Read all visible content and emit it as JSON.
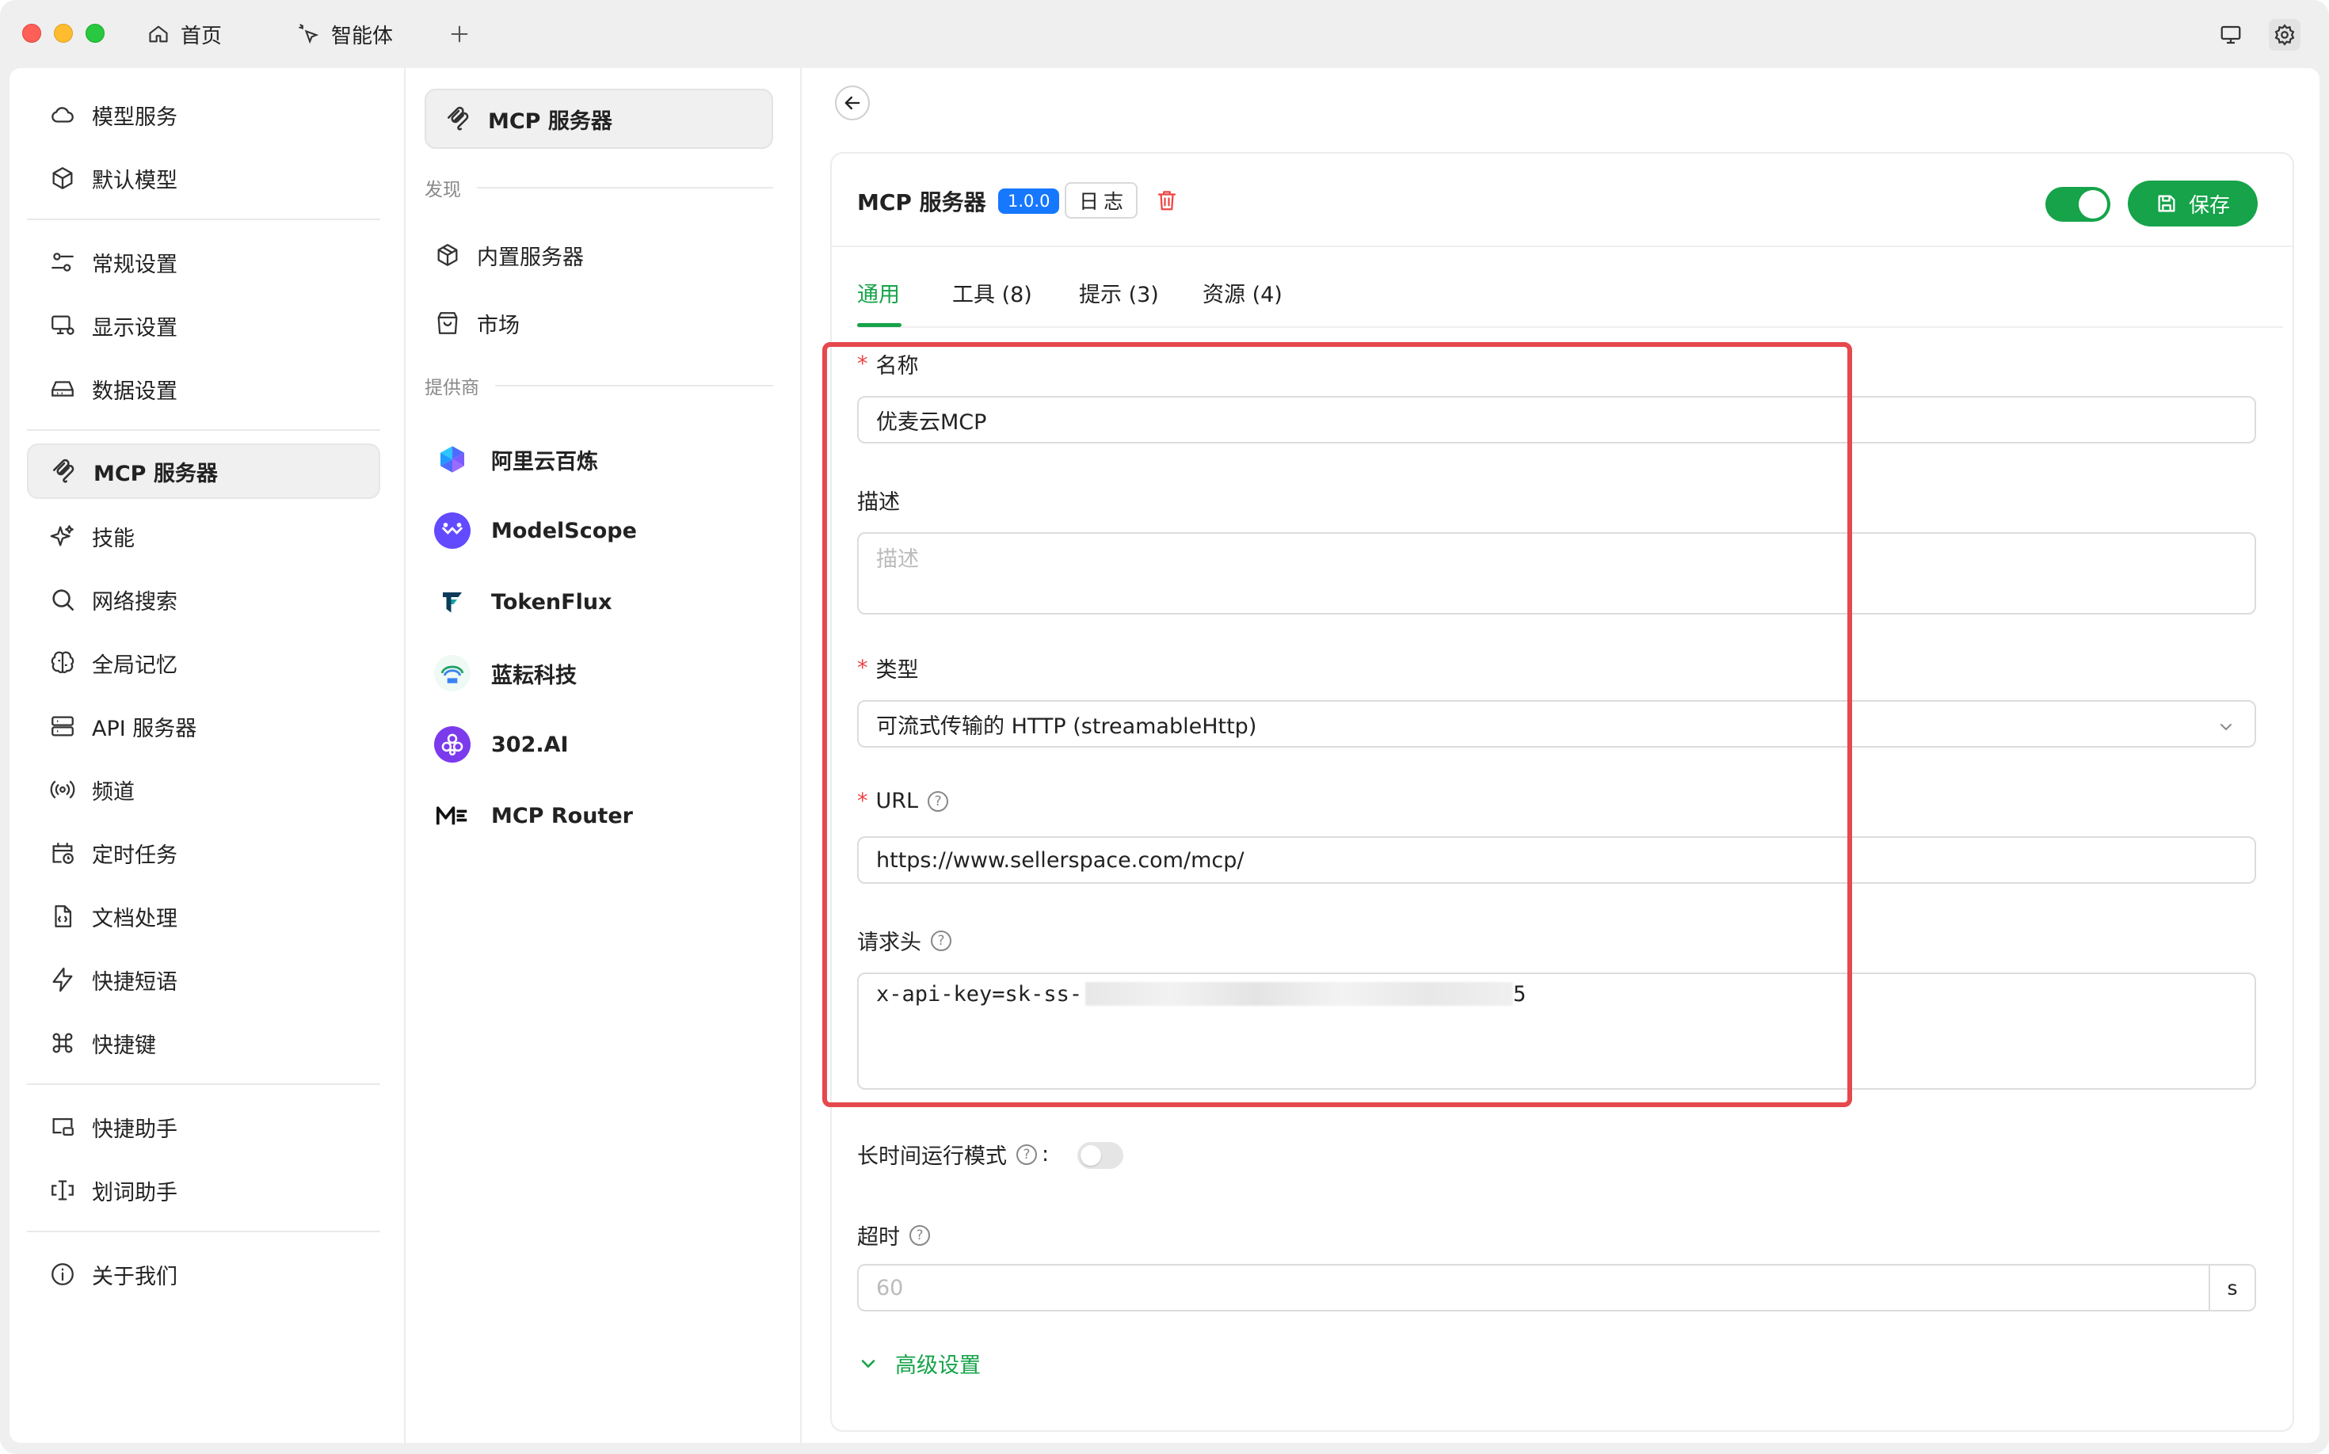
{
  "topbar": {
    "tabs": [
      {
        "label": "首页",
        "icon": "home-icon"
      },
      {
        "label": "智能体",
        "icon": "agent-icon"
      }
    ],
    "add_label": "+"
  },
  "sidebar": {
    "items": [
      {
        "label": "模型服务",
        "icon": "cloud-icon"
      },
      {
        "label": "默认模型",
        "icon": "cube-icon"
      },
      {
        "label": "常规设置",
        "icon": "sliders-icon"
      },
      {
        "label": "显示设置",
        "icon": "monitor-settings-icon"
      },
      {
        "label": "数据设置",
        "icon": "storage-icon"
      },
      {
        "label": "MCP 服务器",
        "icon": "mcp-icon",
        "active": true
      },
      {
        "label": "技能",
        "icon": "sparkle-icon"
      },
      {
        "label": "网络搜索",
        "icon": "search-icon"
      },
      {
        "label": "全局记忆",
        "icon": "brain-icon"
      },
      {
        "label": "API 服务器",
        "icon": "server-icon"
      },
      {
        "label": "频道",
        "icon": "broadcast-icon"
      },
      {
        "label": "定时任务",
        "icon": "calendar-clock-icon"
      },
      {
        "label": "文档处理",
        "icon": "document-code-icon"
      },
      {
        "label": "快捷短语",
        "icon": "bolt-icon"
      },
      {
        "label": "快捷键",
        "icon": "command-icon"
      },
      {
        "label": "快捷助手",
        "icon": "assistant-window-icon"
      },
      {
        "label": "划词助手",
        "icon": "text-select-icon"
      },
      {
        "label": "关于我们",
        "icon": "info-icon"
      }
    ]
  },
  "mcp_nav": {
    "top_label": "MCP 服务器",
    "discover_label": "发现",
    "discover_items": [
      {
        "label": "内置服务器",
        "icon": "package-icon"
      },
      {
        "label": "市场",
        "icon": "shopping-bag-icon"
      }
    ],
    "providers_label": "提供商",
    "providers": [
      {
        "label": "阿里云百炼",
        "icon": "bailian-logo-icon",
        "color": "#3b5bfd"
      },
      {
        "label": "ModelScope",
        "icon": "modelscope-logo-icon",
        "color": "#624aff"
      },
      {
        "label": "TokenFlux",
        "icon": "tokenflux-logo-icon",
        "color": "#0f766e"
      },
      {
        "label": "蓝耘科技",
        "icon": "lanyun-logo-icon",
        "color": "#22a36a"
      },
      {
        "label": "302.AI",
        "icon": "302ai-logo-icon",
        "color": "#7c3aed"
      },
      {
        "label": "MCP Router",
        "icon": "mcp-router-logo-icon",
        "color": "#111111"
      }
    ]
  },
  "detail": {
    "title": "MCP 服务器",
    "version": "1.0.0",
    "log_label": "日志",
    "save_label": "保存",
    "enabled": true,
    "tabs": [
      {
        "label": "通用",
        "active": true
      },
      {
        "label": "工具 (8)"
      },
      {
        "label": "提示 (3)"
      },
      {
        "label": "资源 (4)"
      }
    ],
    "form": {
      "name_label": "名称",
      "name_value": "优麦云MCP",
      "desc_label": "描述",
      "desc_placeholder": "描述",
      "type_label": "类型",
      "type_value": "可流式传输的 HTTP (streamableHttp)",
      "url_label": "URL",
      "url_value": "https://www.sellerspace.com/mcp/",
      "headers_label": "请求头",
      "headers_value_visible": "x-api-key=sk-ss-",
      "headers_value_tail": "5",
      "long_running_label": "长时间运行模式",
      "long_running_colon": ":",
      "long_running_enabled": false,
      "timeout_label": "超时",
      "timeout_placeholder": "60",
      "timeout_unit": "s",
      "advanced_label": "高级设置"
    }
  },
  "colors": {
    "accent": "#16a34a",
    "badge": "#1677ff",
    "danger": "#ef4444",
    "highlight": "#e5484d"
  }
}
